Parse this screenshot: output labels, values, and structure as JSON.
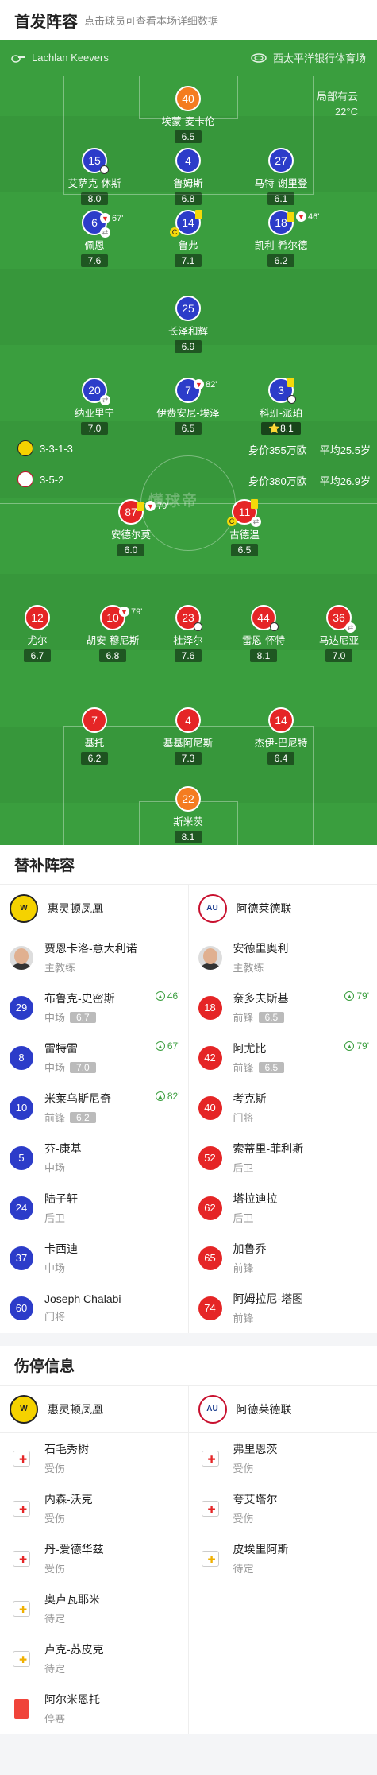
{
  "header": {
    "title": "首发阵容",
    "subtitle": "点击球员可查看本场详细数据"
  },
  "pitch": {
    "referee": "Lachlan Keevers",
    "stadium": "西太平洋银行体育场",
    "weather": "局部有云",
    "temperature": "22°C",
    "brand": "懂球帝",
    "home_formation": "3-3-1-3",
    "home_value": "身价355万欧",
    "home_age": "平均25.5岁",
    "away_formation": "3-5-2",
    "away_value": "身价380万欧",
    "away_age": "平均26.9岁"
  },
  "players": [
    {
      "num": "40",
      "name": "埃蒙-麦卡伦",
      "rating": "6.5"
    },
    {
      "num": "15",
      "name": "艾萨克-休斯",
      "rating": "8.0"
    },
    {
      "num": "4",
      "name": "鲁姆斯",
      "rating": "6.8"
    },
    {
      "num": "27",
      "name": "马特-谢里登",
      "rating": "6.1"
    },
    {
      "num": "6",
      "name": "佩恩",
      "rating": "7.6",
      "minute": "67'"
    },
    {
      "num": "14",
      "name": "鲁弗",
      "rating": "7.1",
      "cap": "C"
    },
    {
      "num": "18",
      "name": "凯利-希尔德",
      "rating": "6.2",
      "minute": "46'"
    },
    {
      "num": "25",
      "name": "长泽和辉",
      "rating": "6.9"
    },
    {
      "num": "20",
      "name": "纳亚里宁",
      "rating": "7.0"
    },
    {
      "num": "7",
      "name": "伊费安尼-埃泽",
      "rating": "6.5",
      "minute": "82'"
    },
    {
      "num": "3",
      "name": "科班-派珀",
      "rating": "8.1"
    },
    {
      "num": "87",
      "name": "安德尔莫",
      "rating": "6.0",
      "minute": "79'"
    },
    {
      "num": "11",
      "name": "古德温",
      "rating": "6.5",
      "cap": "C"
    },
    {
      "num": "12",
      "name": "尤尔",
      "rating": "6.7"
    },
    {
      "num": "10",
      "name": "胡安-穆尼斯",
      "rating": "6.8",
      "minute": "79'"
    },
    {
      "num": "23",
      "name": "杜泽尔",
      "rating": "7.6"
    },
    {
      "num": "44",
      "name": "雷恩-怀特",
      "rating": "8.1"
    },
    {
      "num": "36",
      "name": "马达尼亚",
      "rating": "7.0"
    },
    {
      "num": "7",
      "name": "基托",
      "rating": "6.2"
    },
    {
      "num": "4",
      "name": "基基阿尼斯",
      "rating": "7.3"
    },
    {
      "num": "14",
      "name": "杰伊-巴尼特",
      "rating": "6.4"
    },
    {
      "num": "22",
      "name": "斯米茨",
      "rating": "8.1"
    }
  ],
  "subs": {
    "title": "替补阵容",
    "home_team": "惠灵顿凤凰",
    "away_team": "阿德莱德联",
    "home_coach": {
      "name": "贾恩卡洛-意大利诺",
      "role": "主教练"
    },
    "away_coach": {
      "name": "安德里奥利",
      "role": "主教练"
    },
    "home": [
      {
        "num": "29",
        "name": "布鲁克-史密斯",
        "pos": "中场",
        "rating": "6.7",
        "minute": "46'"
      },
      {
        "num": "8",
        "name": "雷特雷",
        "pos": "中场",
        "rating": "7.0",
        "minute": "67'"
      },
      {
        "num": "10",
        "name": "米莱乌斯尼奇",
        "pos": "前锋",
        "rating": "6.2",
        "minute": "82'"
      },
      {
        "num": "5",
        "name": "芬-康基",
        "pos": "中场"
      },
      {
        "num": "24",
        "name": "陆子轩",
        "pos": "后卫"
      },
      {
        "num": "37",
        "name": "卡西迪",
        "pos": "中场"
      },
      {
        "num": "60",
        "name": "Joseph Chalabi",
        "pos": "门将"
      }
    ],
    "away": [
      {
        "num": "18",
        "name": "奈多夫斯基",
        "pos": "前锋",
        "rating": "6.5",
        "minute": "79'"
      },
      {
        "num": "42",
        "name": "阿尤比",
        "pos": "前锋",
        "rating": "6.5",
        "minute": "79'"
      },
      {
        "num": "40",
        "name": "考克斯",
        "pos": "门将"
      },
      {
        "num": "52",
        "name": "索蒂里-菲利斯",
        "pos": "后卫"
      },
      {
        "num": "62",
        "name": "塔拉迪拉",
        "pos": "后卫"
      },
      {
        "num": "65",
        "name": "加鲁乔",
        "pos": "前锋"
      },
      {
        "num": "74",
        "name": "阿姆拉尼-塔图",
        "pos": "前锋"
      }
    ]
  },
  "injuries": {
    "title": "伤停信息",
    "home": [
      {
        "name": "石毛秀树",
        "status": "受伤"
      },
      {
        "name": "内森-沃克",
        "status": "受伤"
      },
      {
        "name": "丹-爱德华兹",
        "status": "受伤"
      },
      {
        "name": "奥卢瓦耶米",
        "status": "待定"
      },
      {
        "name": "卢克-苏皮克",
        "status": "待定"
      },
      {
        "name": "阿尔米恩托",
        "status": "停赛"
      }
    ],
    "away": [
      {
        "name": "弗里恩茨",
        "status": "受伤"
      },
      {
        "name": "夸艾塔尔",
        "status": "受伤"
      },
      {
        "name": "皮埃里阿斯",
        "status": "待定"
      }
    ]
  }
}
